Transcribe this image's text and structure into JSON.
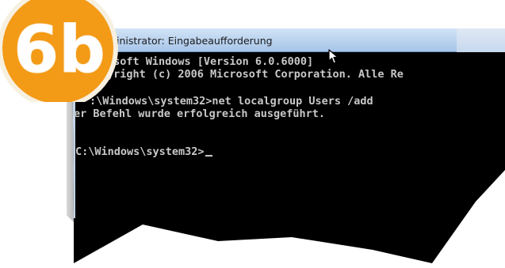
{
  "window": {
    "title": "Administrator: Eingabeaufforderung",
    "title_visible": "inistrator: Eingabeaufforderung"
  },
  "console": {
    "lines": [
      "osoft Windows [Version 6.0.6000]",
      "yright (c) 2006 Microsoft Corporation. Alle Re",
      "",
      ":\\Windows\\system32>net localgroup Users /add",
      "er Befehl wurde erfolgreich ausgeführt.",
      "",
      "C:\\Windows\\system32>"
    ],
    "text_color": "#c8c8c8",
    "background_color": "#000000"
  },
  "logo": {
    "text": "6b",
    "fill_color": "#f39a17",
    "ring_color": "#f7f0e0",
    "text_color": "#ffffff"
  },
  "icons": {
    "cursor": "mouse-pointer-icon"
  }
}
